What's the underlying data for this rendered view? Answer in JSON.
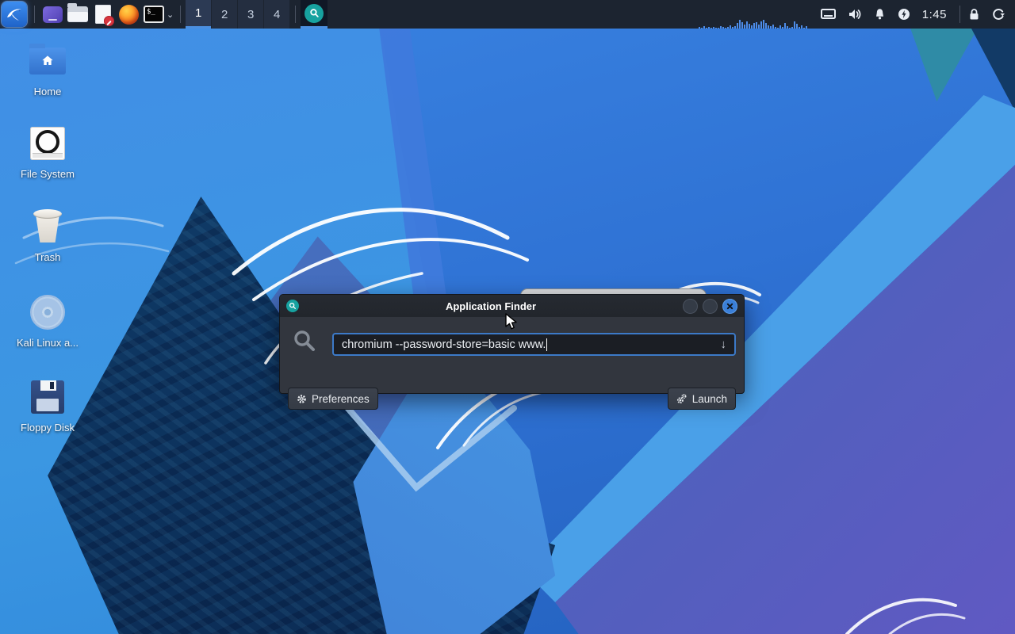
{
  "panel": {
    "menu": {
      "name": "kali-menu"
    },
    "launcher_icons": [
      "window-manager-icon",
      "file-manager-icon",
      "text-editor-icon",
      "firefox-icon",
      "terminal-icon"
    ],
    "terminal_glyph": "$_",
    "dropdown_glyph": "⌄",
    "workspaces": {
      "items": [
        "1",
        "2",
        "3",
        "4"
      ],
      "active_index": 0
    },
    "task_button": {
      "name": "application-finder",
      "active": true
    },
    "cpu_bars": [
      2,
      1,
      3,
      1,
      2,
      1,
      2,
      1,
      1,
      3,
      2,
      1,
      2,
      4,
      2,
      3,
      7,
      11,
      8,
      5,
      9,
      6,
      4,
      7,
      8,
      5,
      9,
      11,
      7,
      4,
      3,
      5,
      2,
      1,
      4,
      2,
      7,
      3,
      1,
      2,
      9,
      6,
      2,
      4,
      1,
      3
    ],
    "tray": {
      "icons": [
        "display-icon",
        "volume-icon",
        "notifications-icon",
        "power-icon"
      ],
      "clock": "1:45",
      "actions": [
        "lock-icon",
        "logout-icon"
      ]
    }
  },
  "desktop": {
    "icons": [
      {
        "label": "Home",
        "type": "home"
      },
      {
        "label": "File System",
        "type": "filesystem"
      },
      {
        "label": "Trash",
        "type": "trash"
      },
      {
        "label": "Kali Linux a...",
        "type": "disc"
      },
      {
        "label": "Floppy Disk",
        "type": "floppy"
      }
    ]
  },
  "finder": {
    "title": "Application Finder",
    "query": "chromium --password-store=basic www.",
    "entry_dropdown_glyph": "↓",
    "buttons": {
      "preferences": "Preferences",
      "launch": "Launch"
    },
    "accent": "#3c7ac8"
  },
  "colors": {
    "panel_bg": "#1c2430",
    "panel_accent": "#4b8fe0",
    "dialog_bg": "#32363e",
    "close_button": "#3a7fd8",
    "finder_icon": "#17a2a0",
    "wallpaper_base": "#2f72d4",
    "wallpaper_dark": "#0b2c55",
    "wallpaper_purple": "#6059c2",
    "wallpaper_teal": "#2f8ba6"
  }
}
